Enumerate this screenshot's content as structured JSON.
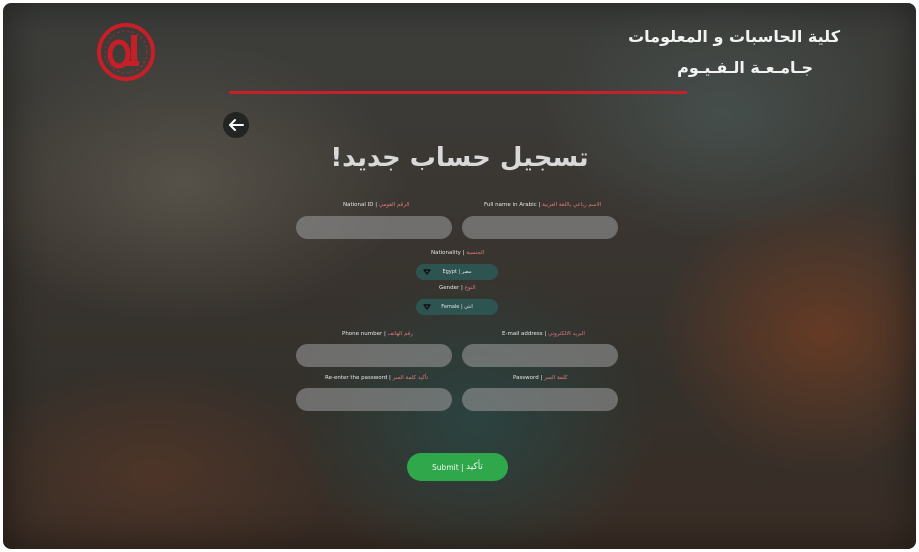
{
  "header": {
    "faculty_name": "كلية الحاسبات و المعلومات",
    "university_name": "جـامـعـة الـفـيـوم",
    "logo_icon": "fci-logo-icon",
    "accent_line_color": "#c8202a"
  },
  "page": {
    "title": "تسجيل حساب جديد!",
    "back_icon": "arrow-left-icon"
  },
  "form": {
    "national_id": {
      "label_en": "National ID",
      "label_ar": "الرقم القومي",
      "value": ""
    },
    "full_name_ar": {
      "label_en": "Full name in Arabic",
      "label_ar": "الاسم رباعي باللغة العربية",
      "value": ""
    },
    "nationality": {
      "label_en": "Nationality",
      "label_ar": "الجنسية",
      "selected_en": "Egypt",
      "selected_ar": "مصر"
    },
    "gender": {
      "label_en": "Gender",
      "label_ar": "النوع",
      "selected_en": "Female",
      "selected_ar": "انثي"
    },
    "phone": {
      "label_en": "Phone number",
      "label_ar": "رقم الهاتف",
      "value": ""
    },
    "email": {
      "label_en": "E-mail address",
      "label_ar": "البريد الالكتروني",
      "value": ""
    },
    "password_confirm": {
      "label_en": "Re-enter the password",
      "label_ar": "تأكيد كلمة السر",
      "value": ""
    },
    "password": {
      "label_en": "Password",
      "label_ar": "كلمة السر",
      "value": ""
    },
    "submit": {
      "label_en": "Submit",
      "label_ar": "تأكيد",
      "color": "#2ea84a"
    },
    "separator": "|"
  }
}
